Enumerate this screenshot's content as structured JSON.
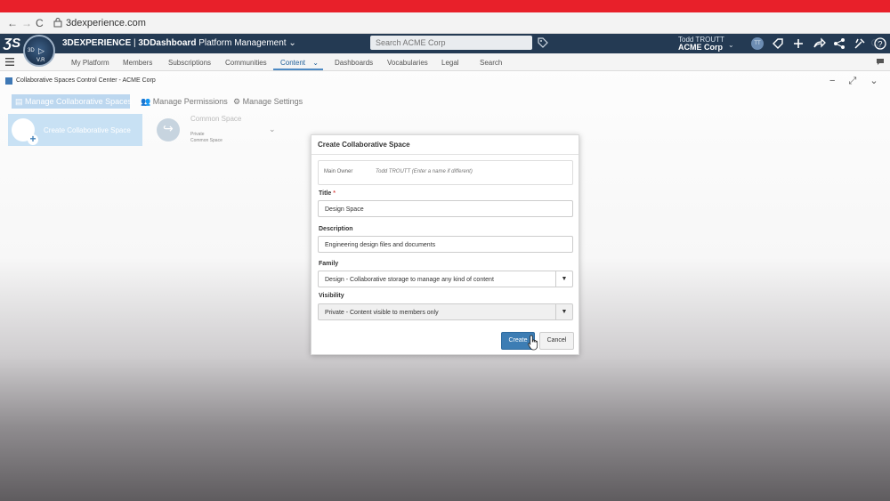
{
  "browser": {
    "url": "3dexperience.com",
    "back": "←",
    "forward": "→",
    "reload": "C"
  },
  "topbar": {
    "brand_bold": "3DEXPERIENCE",
    "brand_sep": " | ",
    "brand_app": "3DDashboard",
    "brand_module": " Platform Management",
    "search_placeholder": "Search ACME Corp",
    "user_name": "Todd TROUTT",
    "user_company": "ACME Corp",
    "avatar_initials": "TT",
    "compass_labels": [
      "3D",
      "V.R"
    ]
  },
  "menu": {
    "tabs": [
      "My Platform",
      "Members",
      "Subscriptions",
      "Communities",
      "Content",
      "Dashboards",
      "Vocabularies",
      "Legal",
      "Search"
    ],
    "active": "Content"
  },
  "app": {
    "title": "Collaborative Spaces Control Center - ACME Corp",
    "subtabs": {
      "manage_spaces": "Manage Collaborative Spaces",
      "manage_permissions": "Manage Permissions",
      "manage_settings": "Manage Settings"
    },
    "create_card": "Create Collaborative Space",
    "common_card": {
      "title": "Common Space",
      "line1": "Private",
      "line2": "Common Space"
    }
  },
  "dialog": {
    "title": "Create Collaborative Space",
    "owner_label": "Main Owner",
    "owner_value": "Todd TROUTT (Enter a name if different)",
    "title_label": "Title",
    "required_mark": "*",
    "title_value": "Design Space",
    "description_label": "Description",
    "description_value": "Engineering design files and documents",
    "family_label": "Family",
    "family_value": "Design - Collaborative storage to manage any kind of content",
    "visibility_label": "Visibility",
    "visibility_value": "Private - Content visible to members only",
    "create_label": "Create",
    "cancel_label": "Cancel"
  },
  "colors": {
    "topbar": "#243a53",
    "accent": "#3d7db4",
    "redbar": "#e8202a"
  }
}
